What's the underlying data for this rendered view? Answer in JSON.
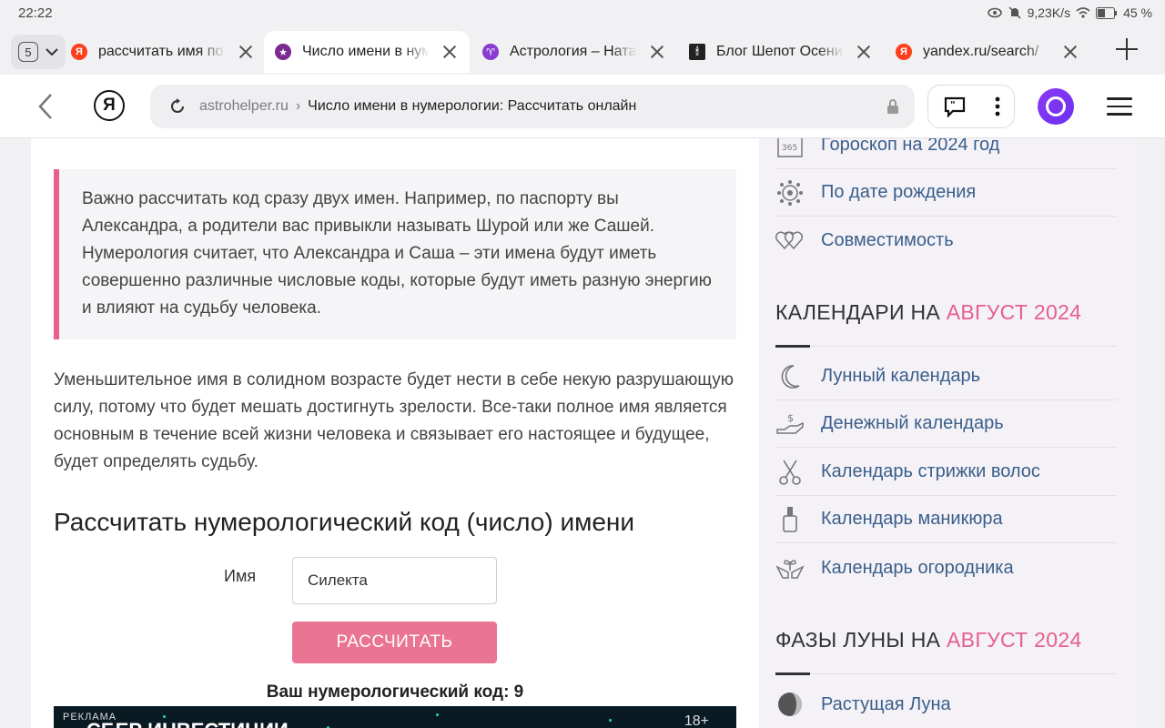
{
  "status_bar": {
    "time": "22:22",
    "net_speed": "9,23K/s",
    "battery": "45 %"
  },
  "tabs": {
    "count": "5",
    "items": [
      {
        "title": "рассчитать имя по нумерологии",
        "favicon": "yandex-icon",
        "color": "#fc3f1d"
      },
      {
        "title": "Число имени в нумерологии",
        "favicon": "astrohelper-icon",
        "color": "#7b2a8f"
      },
      {
        "title": "Астрология – Натальная карта",
        "favicon": "astrology-icon",
        "color": "#8a3bd0"
      },
      {
        "title": "Блог Шепот Осени",
        "favicon": "blog-icon",
        "color": "#222222"
      },
      {
        "title": "yandex.ru/search/",
        "favicon": "yandex-icon",
        "color": "#fc3f1d"
      }
    ]
  },
  "address_bar": {
    "domain": "astrohelper.ru",
    "separator": "›",
    "page_title": "Число имени в нумерологии: Рассчитать онлайн",
    "logo_letter": "Я"
  },
  "article": {
    "quote": "Важно рассчитать код сразу двух имен. Например, по паспорту вы Александра, а родители вас привыкли называть Шурой или же Сашей. Нумерология считает, что Александра и Саша – эти имена будут иметь совершенно различные числовые коды, которые будут иметь разную энергию и влияют на судьбу человека.",
    "paragraph": "Уменьшительное имя в солидном возрасте будет нести в себе некую разрушающую силу, потому что будет мешать достигнуть зрелости. Все-таки полное имя является основным в течение всей жизни человека и связывает его настоящее и будущее, будет определять судьбу.",
    "heading": "Рассчитать нумерологический код (число) имени",
    "form": {
      "label": "Имя",
      "value": "Силекта",
      "button": "РАССЧИТАТЬ"
    },
    "result": "Ваш нумерологический код: 9",
    "ad": {
      "label": "РЕКЛАМА",
      "title": "СБЕР ИНВЕСТИЦИИ",
      "age": "18+"
    }
  },
  "sidebar": {
    "top_items": [
      {
        "label": "Гороскоп на 2024 год",
        "icon": "calendar-365-icon"
      },
      {
        "label": "По дате рождения",
        "icon": "zodiac-wheel-icon"
      },
      {
        "label": "Совместимость",
        "icon": "hearts-icon"
      }
    ],
    "calendars": {
      "heading": "КАЛЕНДАРИ НА",
      "accent": "АВГУСТ 2024",
      "items": [
        {
          "label": "Лунный календарь",
          "icon": "moon-icon"
        },
        {
          "label": "Денежный календарь",
          "icon": "money-hand-icon"
        },
        {
          "label": "Календарь стрижки волос",
          "icon": "scissors-icon"
        },
        {
          "label": "Календарь маникюра",
          "icon": "nail-polish-icon"
        },
        {
          "label": "Календарь огородника",
          "icon": "sprout-hands-icon"
        }
      ]
    },
    "phases": {
      "heading": "ФАЗЫ ЛУНЫ НА",
      "accent": "АВГУСТ 2024",
      "items": [
        {
          "label": "Растущая Луна",
          "icon": "waxing-moon-icon"
        }
      ]
    }
  },
  "colors": {
    "accent_pink": "#e6608a",
    "link_blue": "#3a5f8a",
    "button_pink": "#ea7493"
  }
}
